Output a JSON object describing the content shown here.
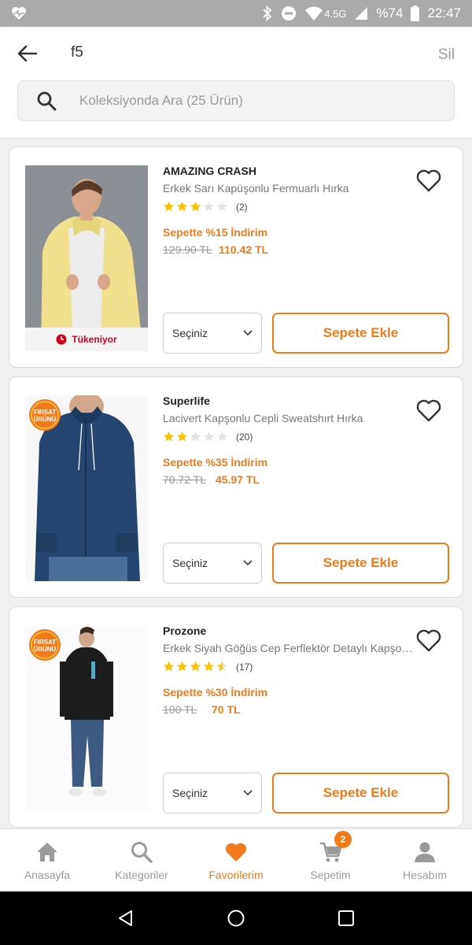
{
  "status_bar": {
    "network": "4.5G",
    "battery": "%74",
    "time": "22:47",
    "icons": [
      "heart-rate-icon",
      "bluetooth-icon",
      "do-not-disturb-icon",
      "wifi-icon",
      "signal-icon",
      "battery-icon"
    ]
  },
  "header": {
    "query": "f5",
    "clear_label": "Sil",
    "search_placeholder": "Koleksiyonda Ara (25 Ürün)"
  },
  "products": [
    {
      "brand": "AMAZING CRASH",
      "name": "Erkek Sarı Kapüşonlu Fermuarlı Hırka",
      "rating": 3,
      "rating_count": "(2)",
      "discount": "Sepette %15 İndirim",
      "old_price": "129.90 TL",
      "new_price": "110.42 TL",
      "select_label": "Seçiniz",
      "add_label": "Sepete Ekle",
      "stock_label": "Tükeniyor",
      "badge": ""
    },
    {
      "brand": "Superlife",
      "name": "Lacivert Kapşonlu Cepli Sweatshırt Hırka",
      "rating": 2,
      "rating_count": "(20)",
      "discount": "Sepette %35 İndirim",
      "old_price": "70.72 TL",
      "new_price": "45.97 TL",
      "select_label": "Seçiniz",
      "add_label": "Sepete Ekle",
      "stock_label": "",
      "badge": "FIRSAT ÜRÜNÜ"
    },
    {
      "brand": "Prozone",
      "name": "Erkek Siyah Göğüs Cep Ferflektör Detaylı Kapşonlu Sweatshirt",
      "rating": 4.5,
      "rating_count": "(17)",
      "discount": "Sepette %30 İndirim",
      "old_price": "100 TL",
      "new_price": "70 TL",
      "select_label": "Seçiniz",
      "add_label": "Sepete Ekle",
      "stock_label": "",
      "badge": "FIRSAT ÜRÜNÜ"
    }
  ],
  "bottom_nav": {
    "items": [
      {
        "label": "Anasayfa",
        "icon": "home-icon"
      },
      {
        "label": "Kategoriler",
        "icon": "search-icon"
      },
      {
        "label": "Favorilerim",
        "icon": "heart-icon",
        "active": true
      },
      {
        "label": "Sepetim",
        "icon": "cart-icon",
        "badge": "2"
      },
      {
        "label": "Hesabım",
        "icon": "user-icon"
      }
    ]
  },
  "colors": {
    "accent": "#f27a1a",
    "star": "#ffc000",
    "soldout": "#d0021b"
  }
}
